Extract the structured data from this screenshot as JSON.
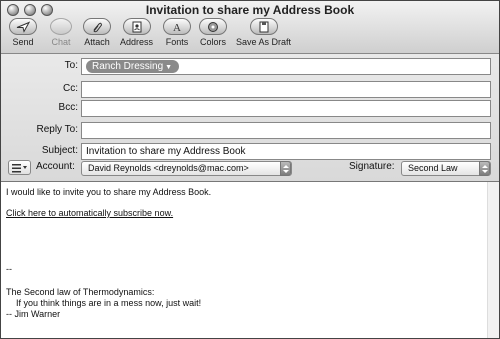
{
  "window": {
    "title": "Invitation to share my Address Book"
  },
  "toolbar": {
    "send": "Send",
    "chat": "Chat",
    "attach": "Attach",
    "address": "Address",
    "fonts": "Fonts",
    "colors": "Colors",
    "save_as_draft": "Save As Draft"
  },
  "header": {
    "to_label": "To:",
    "to_token": "Ranch Dressing",
    "cc_label": "Cc:",
    "cc_value": "",
    "bcc_label": "Bcc:",
    "bcc_value": "",
    "reply_to_label": "Reply To:",
    "reply_to_value": "",
    "subject_label": "Subject:",
    "subject_value": "Invitation to share my Address Book",
    "account_label": "Account:",
    "account_value": "David Reynolds <dreynolds@mac.com>",
    "signature_label": "Signature:",
    "signature_value": "Second Law"
  },
  "message": {
    "line1": "I would like to invite you to share my Address Book.",
    "link": "Click here to automatically subscribe now.",
    "sig_dash": "--",
    "sig_line1": "The Second law of Thermodynamics:",
    "sig_line2": "    If you think things are in a mess now, just wait!",
    "sig_line3": "-- Jim Warner"
  },
  "icons": [
    "send-icon",
    "chat-icon",
    "attach-icon",
    "address-icon",
    "fonts-icon",
    "colors-icon",
    "save-draft-icon"
  ]
}
